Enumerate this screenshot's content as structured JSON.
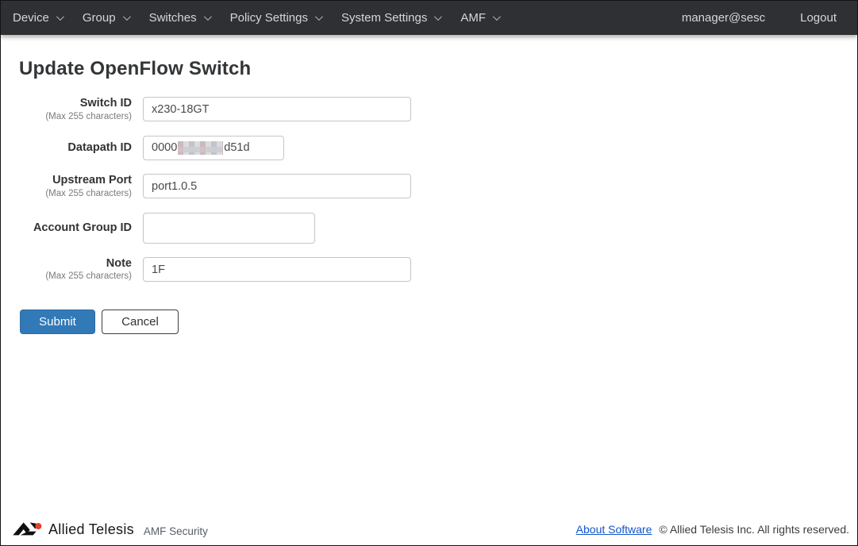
{
  "nav": {
    "items": [
      {
        "label": "Device"
      },
      {
        "label": "Group"
      },
      {
        "label": "Switches"
      },
      {
        "label": "Policy Settings"
      },
      {
        "label": "System Settings"
      },
      {
        "label": "AMF"
      }
    ],
    "user": "manager@sesc",
    "logout_label": "Logout"
  },
  "page": {
    "title": "Update OpenFlow Switch"
  },
  "form": {
    "fields": [
      {
        "label": "Switch ID",
        "note": "(Max 255 characters)",
        "value": "x230-18GT"
      },
      {
        "label": "Datapath ID",
        "note": "",
        "value_prefix": "0000",
        "value_redacted": "[redacted]",
        "value_suffix": "d51d"
      },
      {
        "label": "Upstream Port",
        "note": "(Max 255 characters)",
        "value": "port1.0.5"
      },
      {
        "label": "Account Group ID",
        "note": "",
        "value": ""
      },
      {
        "label": "Note",
        "note": "(Max 255 characters)",
        "value": "1F"
      }
    ],
    "submit_label": "Submit",
    "cancel_label": "Cancel"
  },
  "footer": {
    "brand": "Allied Telesis",
    "product": "AMF Security",
    "about_label": "About Software",
    "copyright": "© Allied Telesis Inc. All rights reserved."
  },
  "colors": {
    "navbar_bg": "#2e3033",
    "submit_blue": "#3279b7",
    "link_blue": "#1155cc",
    "logo_red": "#e8402d"
  }
}
